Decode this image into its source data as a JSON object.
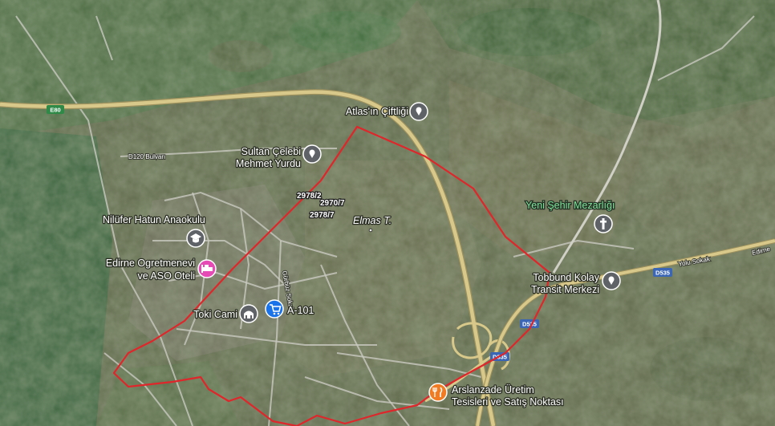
{
  "map": {
    "colors": {
      "highway": "#d8c98a",
      "highway_edge": "#9d915e",
      "street": "#bfbfb8",
      "boundary": "#e0262b",
      "poi_gray": "#5f6368",
      "poi_pink": "#e64bb5",
      "poi_blue": "#1a73e8",
      "poi_orange": "#f07b22"
    },
    "road_labels": {
      "e80": "E80",
      "d120": "D120 Bulvarı",
      "d535_a": "D535",
      "d535_b": "D535",
      "d535_c": "D535",
      "edirne": "Edirne",
      "yolu": "Yolu Sokak",
      "gurbuz": "Gürbüz Sokak"
    },
    "pois": {
      "atlas": "Atlas'ın Çiftliği",
      "sultan_1": "Sultan Çelebi",
      "sultan_2": "Mehmet Yurdu",
      "nilufer": "Nilüfer Hatun Anaokulu",
      "ogretmen_1": "Edirne Ogretmenevi",
      "ogretmen_2": "ve ASO Oteli",
      "toki": "Toki Cami",
      "a101": "A-101",
      "mezarlik": "Yeni Şehir Mezarlığı",
      "tobbund_1": "Tobbund Kolay",
      "tobbund_2": "Transit Merkezi",
      "arslan_1": "Arslanzade Üretim",
      "arslan_2": "Tesisleri ve Satış Noktası",
      "elmas": "Elmas T."
    },
    "parcels": {
      "p1": "2978/2",
      "p2": "2970/7",
      "p3": "2978/7"
    },
    "icons": {
      "atlas": "place-pin-icon",
      "sultan": "place-pin-icon",
      "nilufer": "school-icon",
      "ogretmen": "hotel-icon",
      "toki": "mosque-icon",
      "a101": "shopping-cart-icon",
      "mezarlik": "cemetery-icon",
      "tobbund": "place-pin-icon",
      "arslan": "restaurant-icon"
    }
  }
}
